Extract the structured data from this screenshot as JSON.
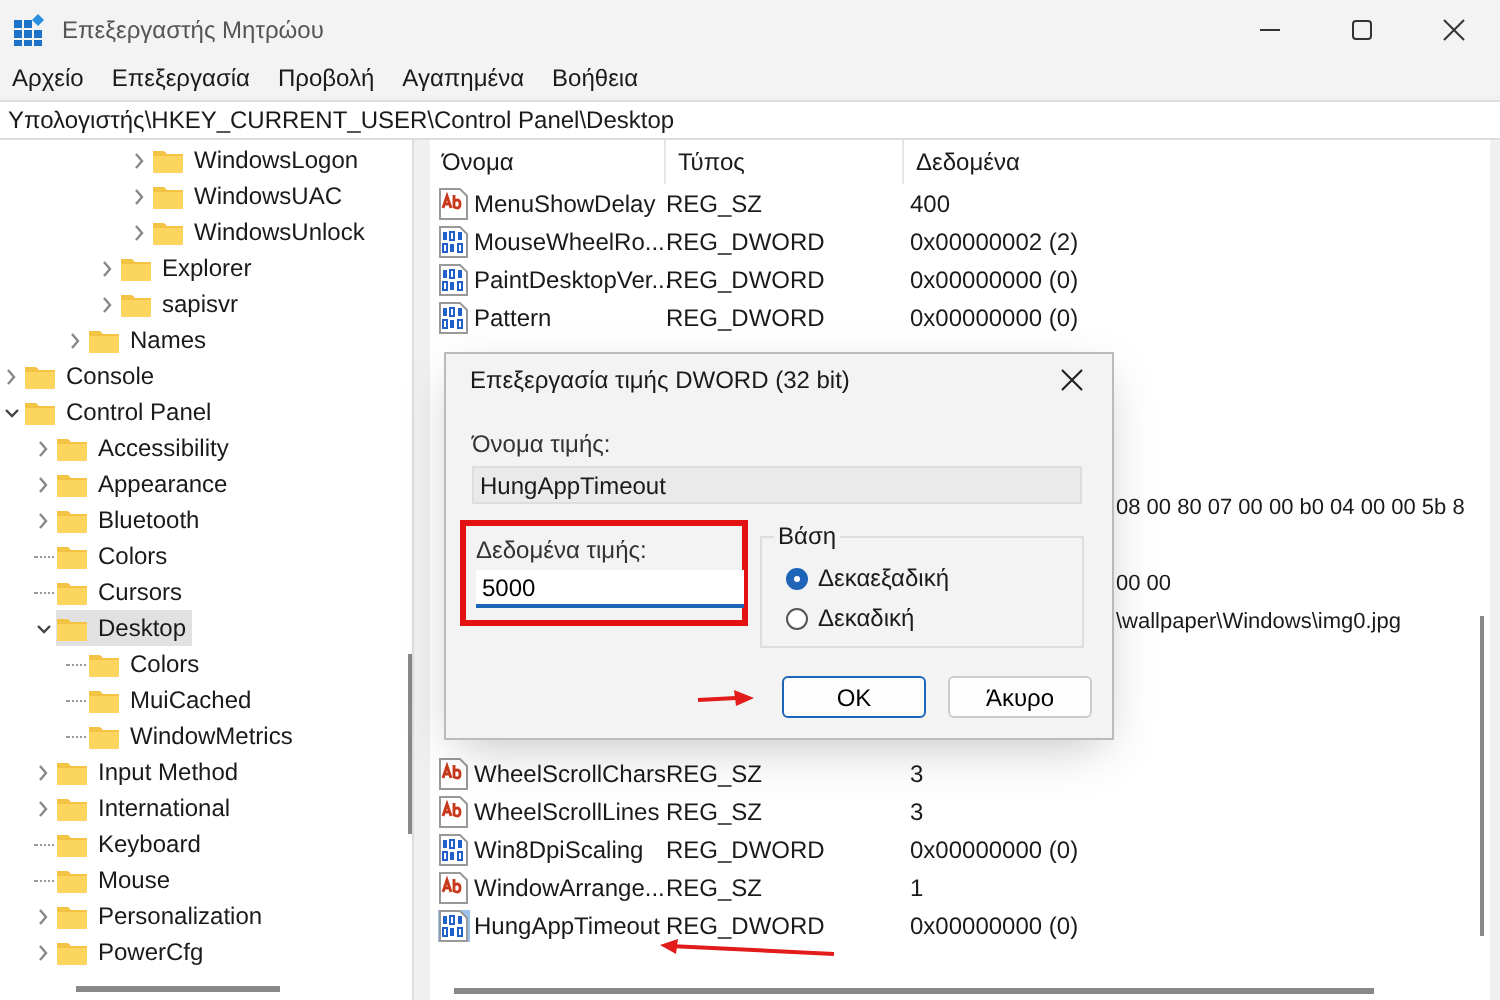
{
  "window": {
    "title": "Επεξεργαστής Μητρώου"
  },
  "menu": [
    "Αρχείο",
    "Επεξεργασία",
    "Προβολή",
    "Αγαπημένα",
    "Βοήθεια"
  ],
  "address": "Υπολογιστής\\HKEY_CURRENT_USER\\Control Panel\\Desktop",
  "tree": {
    "items": [
      {
        "children": [
          {
            "children": [
              {
                "children": [
                  {
                    "children": [
                      {
                        "label": "WindowsLogon",
                        "expanded": false,
                        "selected": false
                      },
                      {
                        "label": "WindowsUAC",
                        "expanded": false,
                        "selected": false
                      },
                      {
                        "label": "WindowsUnlock",
                        "expanded": false,
                        "selected": false
                      }
                    ]
                  },
                  {
                    "label": "Explorer",
                    "expanded": false,
                    "selected": false
                  },
                  {
                    "label": "sapisvr",
                    "expanded": false,
                    "selected": false
                  }
                ]
              },
              {
                "label": "Names",
                "expanded": false,
                "selected": false
              }
            ]
          }
        ]
      },
      {
        "label": "Console",
        "expanded": false,
        "selected": false
      },
      {
        "label": "Control Panel",
        "expanded": true,
        "selected": false,
        "children": [
          {
            "label": "Accessibility",
            "expanded": false,
            "selected": false
          },
          {
            "label": "Appearance",
            "expanded": false,
            "selected": false
          },
          {
            "label": "Bluetooth",
            "expanded": false,
            "selected": false
          },
          {
            "label": "Colors",
            "selected": false
          },
          {
            "label": "Cursors",
            "selected": false
          },
          {
            "label": "Desktop",
            "expanded": true,
            "selected": true,
            "children": [
              {
                "label": "Colors",
                "selected": false
              },
              {
                "label": "MuiCached",
                "selected": false
              },
              {
                "label": "WindowMetrics",
                "selected": false
              }
            ]
          },
          {
            "label": "Input Method",
            "expanded": false,
            "selected": false
          },
          {
            "label": "International",
            "expanded": false,
            "selected": false
          },
          {
            "label": "Keyboard",
            "selected": false
          },
          {
            "label": "Mouse",
            "selected": false
          },
          {
            "label": "Personalization",
            "expanded": false,
            "selected": false
          },
          {
            "label": "PowerCfg",
            "expanded": false,
            "selected": false
          }
        ]
      }
    ]
  },
  "table": {
    "columns": [
      "Όνομα",
      "Τύπος",
      "Δεδομένα"
    ],
    "rows": [
      {
        "kind": "string",
        "name": "MenuShowDelay",
        "type": "REG_SZ",
        "data": "400",
        "selected": false
      },
      {
        "kind": "binary",
        "name": "MouseWheelRo...",
        "type": "REG_DWORD",
        "data": "0x00000002 (2)",
        "selected": false
      },
      {
        "kind": "binary",
        "name": "PaintDesktopVer...",
        "type": "REG_DWORD",
        "data": "0x00000000 (0)",
        "selected": false
      },
      {
        "kind": "binary",
        "name": "Pattern",
        "type": "REG_DWORD",
        "data": "0x00000000 (0)",
        "selected": false
      },
      {
        "kind": "covered"
      },
      {
        "kind": "covered"
      },
      {
        "kind": "covered"
      },
      {
        "kind": "covered"
      },
      {
        "kind": "covered",
        "data": "08 00 80 07 00 00 b0 04 00 00 5b 8"
      },
      {
        "kind": "covered"
      },
      {
        "kind": "covered",
        "data": "00 00"
      },
      {
        "kind": "covered",
        "data": "\\wallpaper\\Windows\\img0.jpg"
      },
      {
        "kind": "covered"
      },
      {
        "kind": "covered"
      },
      {
        "kind": "covered"
      },
      {
        "kind": "string",
        "name": "WheelScrollChars",
        "type": "REG_SZ",
        "data": "3",
        "selected": false
      },
      {
        "kind": "string",
        "name": "WheelScrollLines",
        "type": "REG_SZ",
        "data": "3",
        "selected": false
      },
      {
        "kind": "binary",
        "name": "Win8DpiScaling",
        "type": "REG_DWORD",
        "data": "0x00000000 (0)",
        "selected": false
      },
      {
        "kind": "string",
        "name": "WindowArrange...",
        "type": "REG_SZ",
        "data": "1",
        "selected": false
      },
      {
        "kind": "binary",
        "name": "HungAppTimeout",
        "type": "REG_DWORD",
        "data": "0x00000000 (0)",
        "selected": true,
        "arrow": true
      }
    ]
  },
  "dialog": {
    "title": "Επεξεργασία τιμής DWORD (32 bit)",
    "name_label": "Όνομα τιμής:",
    "name_value": "HungAppTimeout",
    "data_label": "Δεδομένα τιμής:",
    "data_value": "5000",
    "highlighted": true,
    "base_label": "Βάση",
    "radios": [
      {
        "label": "Δεκαεξαδική",
        "selected": true
      },
      {
        "label": "Δεκαδική",
        "selected": false
      }
    ],
    "buttons": [
      {
        "label": "OK",
        "default": true,
        "arrow": true
      },
      {
        "label": "Άκυρο",
        "default": false,
        "arrow": false
      }
    ]
  }
}
